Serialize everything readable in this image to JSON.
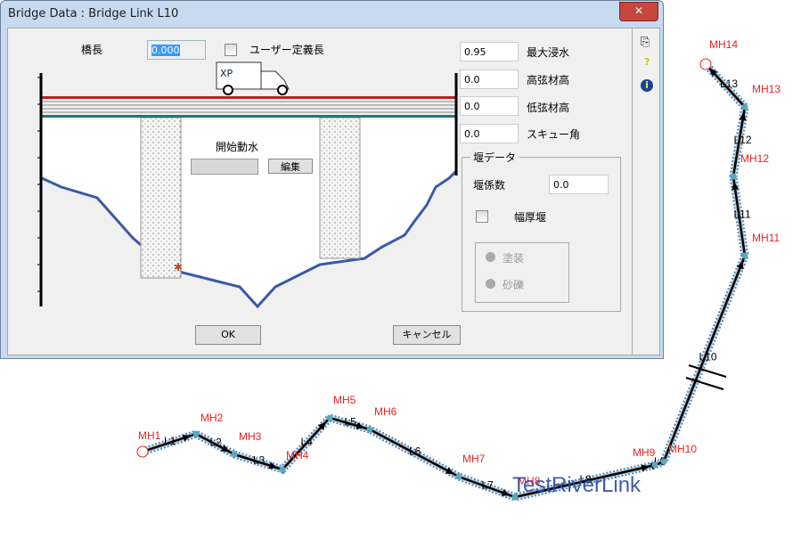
{
  "dialog": {
    "title": "Bridge Data : Bridge Link L10",
    "close": "✕",
    "bridge_length_label": "橋長",
    "bridge_length_value": "0.000",
    "user_defined_length_label": "ユーザー定義長",
    "start_water_label": "開始動水",
    "edit_button": "編集",
    "fields": [
      {
        "value": "0.95",
        "label": "最大浸水"
      },
      {
        "value": "0.0",
        "label": "高弦材高"
      },
      {
        "value": "0.0",
        "label": "低弦材高"
      },
      {
        "value": "0.0",
        "label": "スキュー角"
      }
    ],
    "weir": {
      "title": "堰データ",
      "coef_label": "堰係数",
      "coef_value": "0.0",
      "broad_crested_label": "幅厚堰",
      "options": [
        "塗装",
        "砂礫"
      ]
    },
    "ok": "OK",
    "cancel": "キャンセル",
    "truck_logo": "XP Solutions"
  },
  "network": {
    "title": "TestRiverLink",
    "nodes": [
      "MH1",
      "MH2",
      "MH3",
      "MH4",
      "MH5",
      "MH6",
      "MH7",
      "MH8",
      "MH9",
      "MH10",
      "MH11",
      "MH12",
      "MH13",
      "MH14"
    ],
    "links": [
      "L1",
      "L2",
      "L3",
      "L4",
      "L5",
      "L6",
      "L7",
      "L8",
      "L9",
      "L10",
      "L11",
      "L12",
      "L13"
    ]
  }
}
